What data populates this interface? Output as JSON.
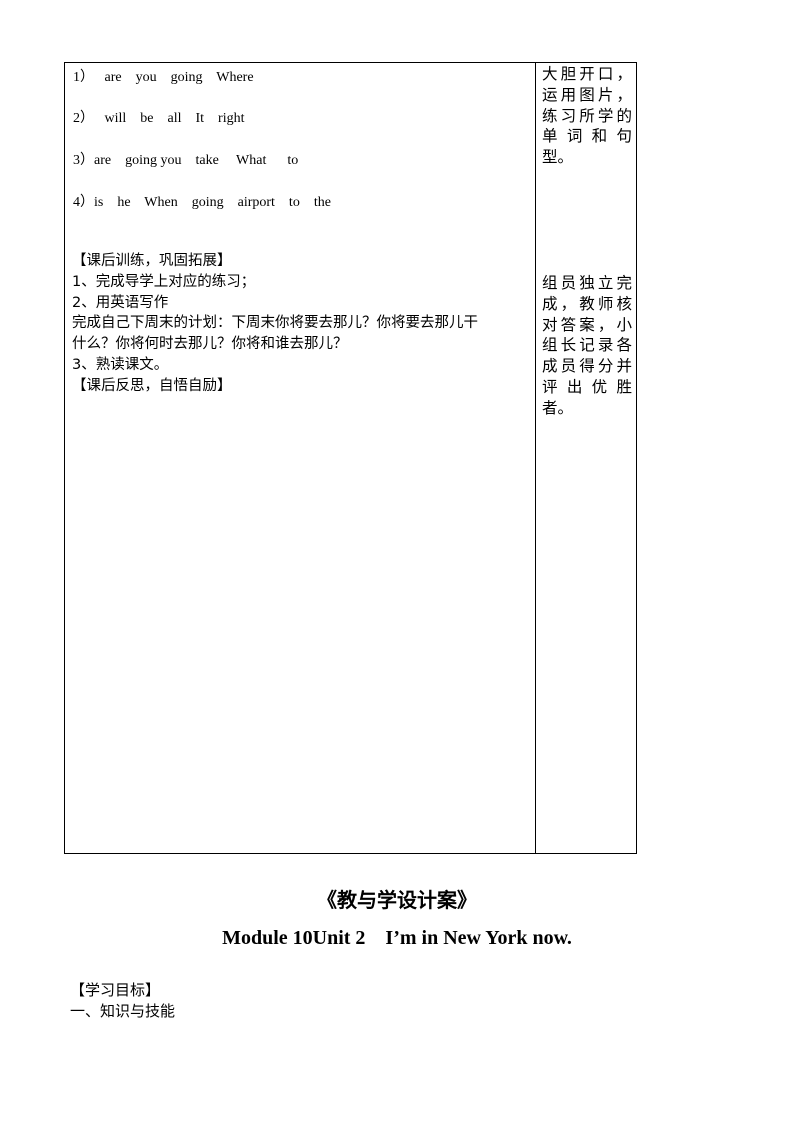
{
  "table": {
    "sentences": [
      "1）   are    you    going    Where",
      "2）   will    be    all    It    right",
      "3）are    going you    take     What      to",
      "4）is    he    When    going    airport    to    the"
    ],
    "homework": {
      "heading": "【课后训练，巩固拓展】",
      "items": [
        "1、完成导学上对应的练习；",
        "2、用英语写作",
        "完成自己下周末的计划：下周末你将要去那儿？你将要去那儿干",
        "什么？你将何时去那儿？你将和谁去那儿？",
        "3、熟读课文。"
      ],
      "reflection_heading": "【课后反思，自悟自励】"
    },
    "notes": [
      [
        "大胆开口，",
        "运用图片，",
        "练习所学的",
        "单词和句",
        "型。"
      ],
      [
        "组员独立完",
        "成，教师核",
        "对答案，小",
        "组长记录各",
        "成员得分并",
        "评出优胜",
        "者。"
      ]
    ]
  },
  "title": "《教与学设计案》",
  "subtitle": "Module 10Unit 2    I’m in New York now.",
  "objectives": {
    "heading": "【学习目标】",
    "item1": "一、知识与技能"
  }
}
